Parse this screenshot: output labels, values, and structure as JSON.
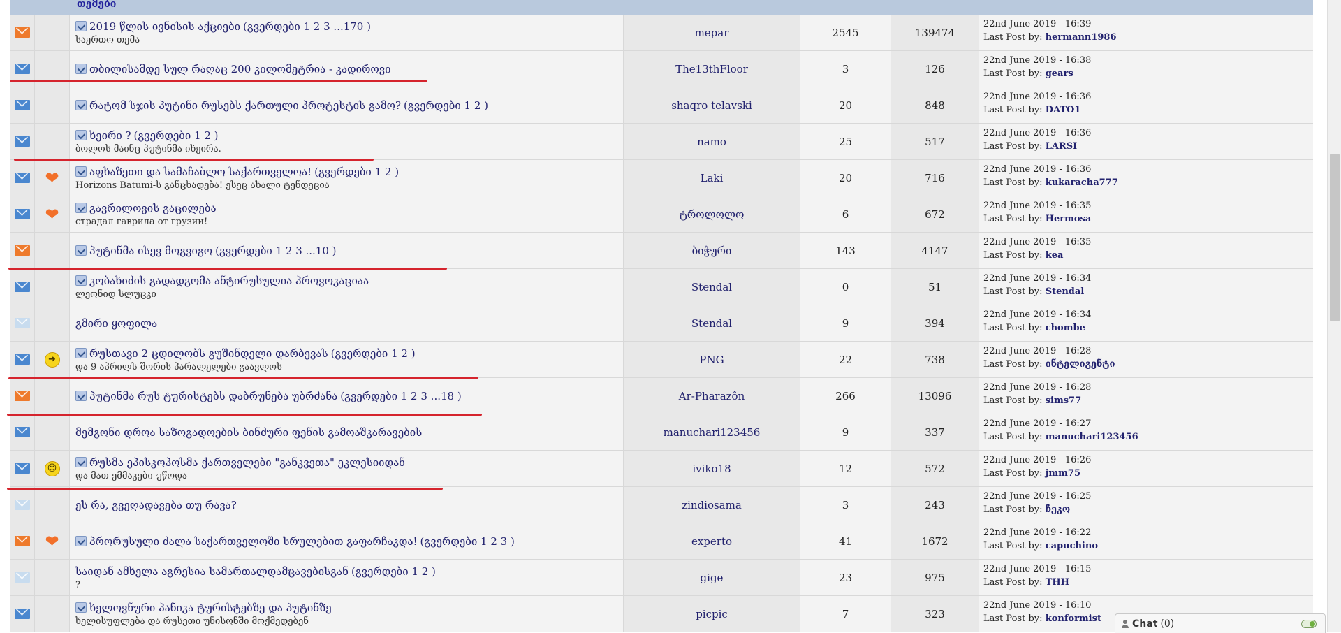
{
  "header": {
    "label": "თემები"
  },
  "rows": [
    {
      "status": "orange",
      "emoji": "",
      "title": "2019 წლის ივნისის აქციები",
      "pages": "(გვერდები 1 2 3 ...170 )",
      "desc": "საერთო თემა",
      "author": "mepar",
      "replies": "2545",
      "views": "139474",
      "date": "22nd June 2019 - 16:39",
      "last_label": "Last Post by:",
      "last_user": "hermann1986",
      "icon": true
    },
    {
      "status": "blue",
      "emoji": "",
      "title": "თბილისამდე სულ რაღაც 200 კილომეტრია - კადიროვი",
      "pages": "",
      "desc": "",
      "author": "The13thFloor",
      "replies": "3",
      "views": "126",
      "date": "22nd June 2019 - 16:38",
      "last_label": "Last Post by:",
      "last_user": "gears",
      "icon": true
    },
    {
      "status": "blue",
      "emoji": "",
      "title": "რატომ სჯის პუტინი რუსებს ქართული პროტესტის გამო?",
      "pages": "(გვერდები 1 2 )",
      "desc": "",
      "author": "shaqro telavski",
      "replies": "20",
      "views": "848",
      "date": "22nd June 2019 - 16:36",
      "last_label": "Last Post by:",
      "last_user": "DATO1",
      "icon": true
    },
    {
      "status": "blue",
      "emoji": "",
      "title": "ხეირი ?",
      "pages": "(გვერდები 1 2 )",
      "desc": "ბოლოს მაინც პუტინმა იხეირა.",
      "author": "namo",
      "replies": "25",
      "views": "517",
      "date": "22nd June 2019 - 16:36",
      "last_label": "Last Post by:",
      "last_user": "LARSI",
      "icon": true
    },
    {
      "status": "blue",
      "emoji": "heart",
      "title": "აფხაზეთი და სამაჩაბლო საქართველოა!",
      "pages": "(გვერდები 1 2 )",
      "desc": "Horizons Batumi-ს განცხადება! ესეც ახალი ტენდეცია",
      "author": "Laki",
      "replies": "20",
      "views": "716",
      "date": "22nd June 2019 - 16:36",
      "last_label": "Last Post by:",
      "last_user": "kukaracha777",
      "icon": true
    },
    {
      "status": "blue",
      "emoji": "heart",
      "title": "გავრილოვის გაცილება",
      "pages": "",
      "desc": "страдал гаврила от грузии!",
      "author": "ტროლოლო",
      "replies": "6",
      "views": "672",
      "date": "22nd June 2019 - 16:35",
      "last_label": "Last Post by:",
      "last_user": "Hermosa",
      "icon": true
    },
    {
      "status": "orange",
      "emoji": "",
      "title": "პუტინმა ისევ მოგვიგო",
      "pages": "(გვერდები 1 2 3 ...10 )",
      "desc": "",
      "author": "ბიჭური",
      "replies": "143",
      "views": "4147",
      "date": "22nd June 2019 - 16:35",
      "last_label": "Last Post by:",
      "last_user": "kea",
      "icon": true
    },
    {
      "status": "blue",
      "emoji": "",
      "title": "კობახიძის გადადგომა ანტირუსულია პროვოკაციაა",
      "pages": "",
      "desc": "ლეონიდ სლუცკი",
      "author": "Stendal",
      "replies": "0",
      "views": "51",
      "date": "22nd June 2019 - 16:34",
      "last_label": "Last Post by:",
      "last_user": "Stendal",
      "icon": true
    },
    {
      "status": "faint",
      "emoji": "",
      "title": "გმირი ყოფილა",
      "pages": "",
      "desc": "",
      "author": "Stendal",
      "replies": "9",
      "views": "394",
      "date": "22nd June 2019 - 16:34",
      "last_label": "Last Post by:",
      "last_user": "chombe",
      "icon": false
    },
    {
      "status": "blue",
      "emoji": "arrow",
      "title": "რუსთავი 2 ცდილობს გუშინდელი დარბევას",
      "pages": "(გვერდები 1 2 )",
      "desc": "და 9 აპრილს შორის პარალელები გაავლოს",
      "author": "PNG",
      "replies": "22",
      "views": "738",
      "date": "22nd June 2019 - 16:28",
      "last_label": "Last Post by:",
      "last_user": "ინტელიგენტი",
      "icon": true
    },
    {
      "status": "orange",
      "emoji": "",
      "title": "პუტინმა რუს ტურისტებს დაბრუნება უბრძანა",
      "pages": "(გვერდები 1 2 3 ...18 )",
      "desc": "",
      "author": "Ar-Pharazôn",
      "replies": "266",
      "views": "13096",
      "date": "22nd June 2019 - 16:28",
      "last_label": "Last Post by:",
      "last_user": "sims77",
      "icon": true
    },
    {
      "status": "blue",
      "emoji": "",
      "title": "მემგონი დროა საზოგადოების ბინძური ფენის გამოაშკარავების",
      "pages": "",
      "desc": "",
      "author": "manuchari123456",
      "replies": "9",
      "views": "337",
      "date": "22nd June 2019 - 16:27",
      "last_label": "Last Post by:",
      "last_user": "manuchari123456",
      "icon": false
    },
    {
      "status": "blue",
      "emoji": "laugh",
      "title": "რუსმა ეპისკოპოსმა ქართველები \"განკვეთა\" ეკლესიიდან",
      "pages": "",
      "desc": "და მათ ემმაკები უწოდა",
      "author": "iviko18",
      "replies": "12",
      "views": "572",
      "date": "22nd June 2019 - 16:26",
      "last_label": "Last Post by:",
      "last_user": "jmm75",
      "icon": true
    },
    {
      "status": "faint",
      "emoji": "",
      "title": "ეს რა, გვეღადავება თუ რავა?",
      "pages": "",
      "desc": "",
      "author": "zindiosama",
      "replies": "3",
      "views": "243",
      "date": "22nd June 2019 - 16:25",
      "last_label": "Last Post by:",
      "last_user": "ჩეკო",
      "icon": false
    },
    {
      "status": "orange",
      "emoji": "heart",
      "title": "პრორუსული ძალა საქართველოში სრულებით გაფარჩაკდა!",
      "pages": "(გვერდები 1 2 3 )",
      "desc": "",
      "author": "experto",
      "replies": "41",
      "views": "1672",
      "date": "22nd June 2019 - 16:22",
      "last_label": "Last Post by:",
      "last_user": "capuchino",
      "icon": true
    },
    {
      "status": "faint",
      "emoji": "",
      "title": "საიდან ამხელა აგრესია სამართალდამცავებისგან",
      "pages": "(გვერდები 1 2 )",
      "desc": "?",
      "author": "gige",
      "replies": "23",
      "views": "975",
      "date": "22nd June 2019 - 16:15",
      "last_label": "Last Post by:",
      "last_user": "THH",
      "icon": false
    },
    {
      "status": "blue",
      "emoji": "",
      "title": "ხელოვნური პანიკა ტურისტებზე და პუტინზე",
      "pages": "",
      "desc": "ხელისუფლება და რუსეთი უნისონში მოქმედებენ",
      "author": "picpic",
      "replies": "7",
      "views": "323",
      "date": "22nd June 2019 - 16:10",
      "last_label": "Last Post by:",
      "last_user": "konformist",
      "icon": true
    }
  ],
  "chat": {
    "label": "Chat",
    "count": "(0)"
  },
  "colors": {
    "accent_text": "#22226e",
    "underline": "#d5242d"
  }
}
